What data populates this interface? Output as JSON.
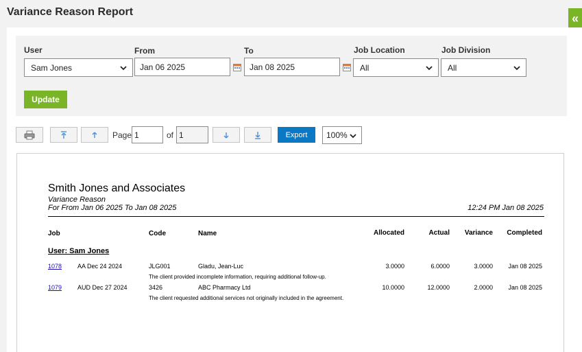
{
  "page": {
    "title": "Variance Reason Report"
  },
  "filters": {
    "user": {
      "label": "User",
      "value": "Sam Jones"
    },
    "from": {
      "label": "From",
      "value": "Jan 06 2025"
    },
    "to": {
      "label": "To",
      "value": "Jan 08 2025"
    },
    "job_location": {
      "label": "Job Location",
      "value": "All"
    },
    "job_division": {
      "label": "Job Division",
      "value": "All"
    },
    "update_label": "Update"
  },
  "toolbar": {
    "page_label": "Page",
    "page_value": "1",
    "of_label": "of",
    "total_pages": "1",
    "export_label": "Export",
    "zoom_value": "100%"
  },
  "report": {
    "company": "Smith Jones and Associates",
    "subtitle": "Variance Reason",
    "range": "For From Jan 06 2025 To Jan 08 2025",
    "printed": "12:24 PM Jan 08 2025",
    "headers": {
      "job": "Job",
      "code": "Code",
      "name": "Name",
      "allocated": "Allocated",
      "actual": "Actual",
      "variance": "Variance",
      "completed": "Completed"
    },
    "group": "User: Sam Jones",
    "rows": [
      {
        "job": "1078",
        "date": "AA Dec 24 2024",
        "code": "JLG001",
        "name": "Gladu, Jean-Luc",
        "allocated": "3.0000",
        "actual": "6.0000",
        "variance": "3.0000",
        "completed": "Jan 08 2025",
        "reason": "The client provided incomplete information, requiring additional follow-up."
      },
      {
        "job": "1079",
        "date": "AUD Dec 27 2024",
        "code": "3426",
        "name": "ABC Pharmacy Ltd",
        "allocated": "10.0000",
        "actual": "12.0000",
        "variance": "2.0000",
        "completed": "Jan 08 2025",
        "reason": "The client requested additional services not originally included in the agreement."
      }
    ]
  },
  "colors": {
    "accent_green": "#7ab427",
    "export_blue": "#0b78c4",
    "link_blue": "#1a0dab"
  },
  "icons": [
    "collapse-panel-icon",
    "chevron-down-icon",
    "calendar-icon",
    "printer-icon",
    "first-page-icon",
    "previous-page-icon",
    "next-page-icon",
    "last-page-icon"
  ]
}
